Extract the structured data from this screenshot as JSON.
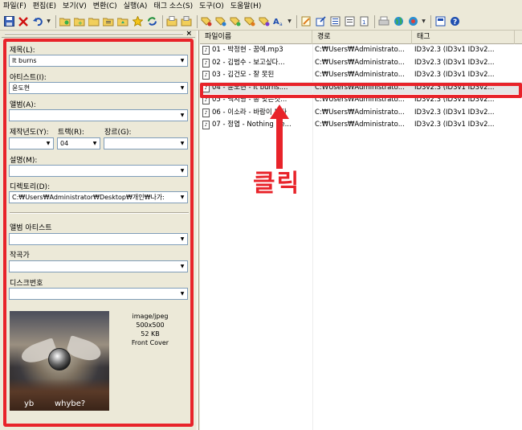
{
  "menu": [
    "파일(F)",
    "편집(E)",
    "보기(V)",
    "변환(C)",
    "실행(A)",
    "태그 소스(S)",
    "도구(O)",
    "도움말(H)"
  ],
  "toolbar_icons": [
    "save-icon",
    "delete-icon",
    "undo-icon",
    "dropdown-arrow-icon",
    "open-folder-icon",
    "add-folder-icon",
    "folder-icon",
    "playlist-folder-icon",
    "folder-up-icon",
    "favorite-star-icon",
    "refresh-icon",
    "copy-tag-icon",
    "paste-tag-icon",
    "tag-to-filename-icon",
    "filename-to-tag-icon",
    "text-to-tag-icon",
    "tag-to-text-icon",
    "case-conversion-icon",
    "text-format-icon",
    "dropdown-arrow-icon",
    "edit-icon",
    "export-icon",
    "playlist-icon",
    "list-icon",
    "page-icon",
    "print-icon",
    "web-source-icon",
    "plugin-icon",
    "dropdown-arrow-icon",
    "settings-icon",
    "help-icon"
  ],
  "tag_panel": {
    "close": "×",
    "title_label": "제목(L):",
    "title_value": "It burns",
    "artist_label": "아티스트(I):",
    "artist_value": "윤도현",
    "album_label": "앨범(A):",
    "album_value": "",
    "year_label": "제작년도(Y):",
    "year_value": "",
    "track_label": "트랙(R):",
    "track_value": "04",
    "genre_label": "장르(G):",
    "genre_value": "",
    "comment_label": "설명(M):",
    "comment_value": "",
    "directory_label": "디렉토리(D):",
    "directory_value": "C:₩Users₩Administrator₩Desktop₩개인₩나가:",
    "album_artist_label": "앨범 아티스트",
    "album_artist_value": "",
    "composer_label": "작곡가",
    "composer_value": "",
    "disc_label": "디스크번호",
    "disc_value": "",
    "cover_text_left": "yb",
    "cover_text_right": "whybe?",
    "image_info": {
      "mime": "image/jpeg",
      "dimensions": "500x500",
      "size": "52 KB",
      "type": "Front Cover"
    }
  },
  "file_list": {
    "columns": [
      "파일이름",
      "경로",
      "태그"
    ],
    "rows": [
      {
        "name": "01 - 박정현 - 꿈에.mp3",
        "path": "C:₩Users₩Administrato...",
        "tag": "ID3v2.3 (ID3v1 ID3v2..."
      },
      {
        "name": "02 - 김범수 - 보고싶다...",
        "path": "C:₩Users₩Administrato...",
        "tag": "ID3v2.3 (ID3v1 ID3v2..."
      },
      {
        "name": "03 - 김건모 - 잘 못된",
        "path": "C:₩Users₩Administrato...",
        "tag": "ID3v2.3 (ID3v1 ID3v2..."
      },
      {
        "name": "04 - 윤도현 - It burns....",
        "path": "C:₩Users₩Administrato...",
        "tag": "ID3v2.3 (ID3v1 ID3v2..."
      },
      {
        "name": "05 - 백지영 - 총 맞은것...",
        "path": "C:₩Users₩Administrato...",
        "tag": "ID3v2.3 (ID3v1 ID3v2..."
      },
      {
        "name": "06 - 이소라 - 바람이 분다",
        "path": "C:₩Users₩Administrato...",
        "tag": "ID3v2.3 (ID3v1 ID3v2..."
      },
      {
        "name": "07 - 정엽 - Nothing Be...",
        "path": "C:₩Users₩Administrato...",
        "tag": "ID3v2.3 (ID3v1 ID3v2..."
      }
    ],
    "selected_row": 3
  },
  "annotation": {
    "text": "클릭",
    "color": "#e8232a"
  }
}
